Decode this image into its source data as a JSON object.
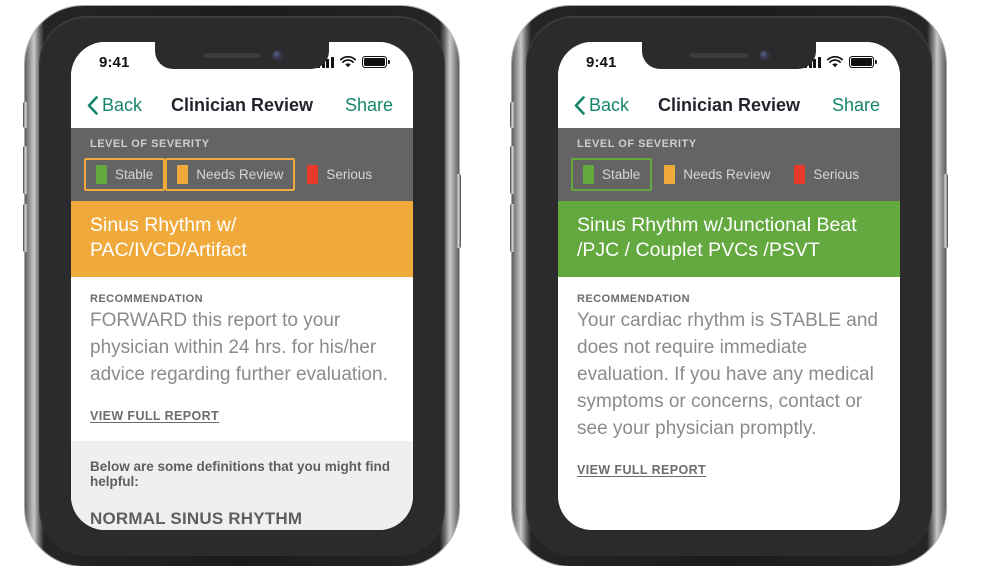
{
  "theme": {
    "accent_teal": "#16866b",
    "stable_green": "#63a93f",
    "needs_review_orange": "#f0a93b",
    "serious_red": "#e8392a",
    "severity_band_gray": "#646464",
    "body_text_gray": "#8b8b8b",
    "definitions_bg": "#efefef"
  },
  "status_bar": {
    "time": "9:41",
    "signal_icon": "cellular-signal-icon",
    "wifi_icon": "wifi-icon",
    "battery_icon": "battery-full-icon"
  },
  "nav": {
    "back_label": "Back",
    "back_icon": "chevron-left-icon",
    "title": "Clinician Review",
    "share_label": "Share"
  },
  "severity": {
    "heading": "LEVEL OF SEVERITY",
    "levels": [
      {
        "label": "Stable",
        "color": "#63a93f"
      },
      {
        "label": "Needs Review",
        "color": "#f0a93b"
      },
      {
        "label": "Serious",
        "color": "#e8392a"
      }
    ]
  },
  "phones": [
    {
      "id": "needs-review",
      "selected_level_index": 1,
      "banner": {
        "text": "Sinus Rhythm w/ PAC/IVCD/Artifact",
        "background": "#f0a93b"
      },
      "recommendation": {
        "kicker": "RECOMMENDATION",
        "text": "FORWARD this report to your physician within 24 hrs. for his/her advice regarding further evaluation.",
        "link_label": "VIEW FULL REPORT"
      },
      "definitions": {
        "intro": "Below are some definitions that you might find helpful:",
        "term": "NORMAL SINUS RHYTHM"
      }
    },
    {
      "id": "stable",
      "selected_level_index": 0,
      "banner": {
        "text": "Sinus Rhythm w/Junctional Beat /PJC / Couplet PVCs /PSVT",
        "background": "#63a93f"
      },
      "recommendation": {
        "kicker": "RECOMMENDATION",
        "text": "Your cardiac rhythm is STABLE and does not require immediate evaluation.  If you have any medical symptoms or concerns, contact or see your physician promptly.",
        "link_label": "VIEW FULL REPORT"
      },
      "definitions": null
    }
  ]
}
